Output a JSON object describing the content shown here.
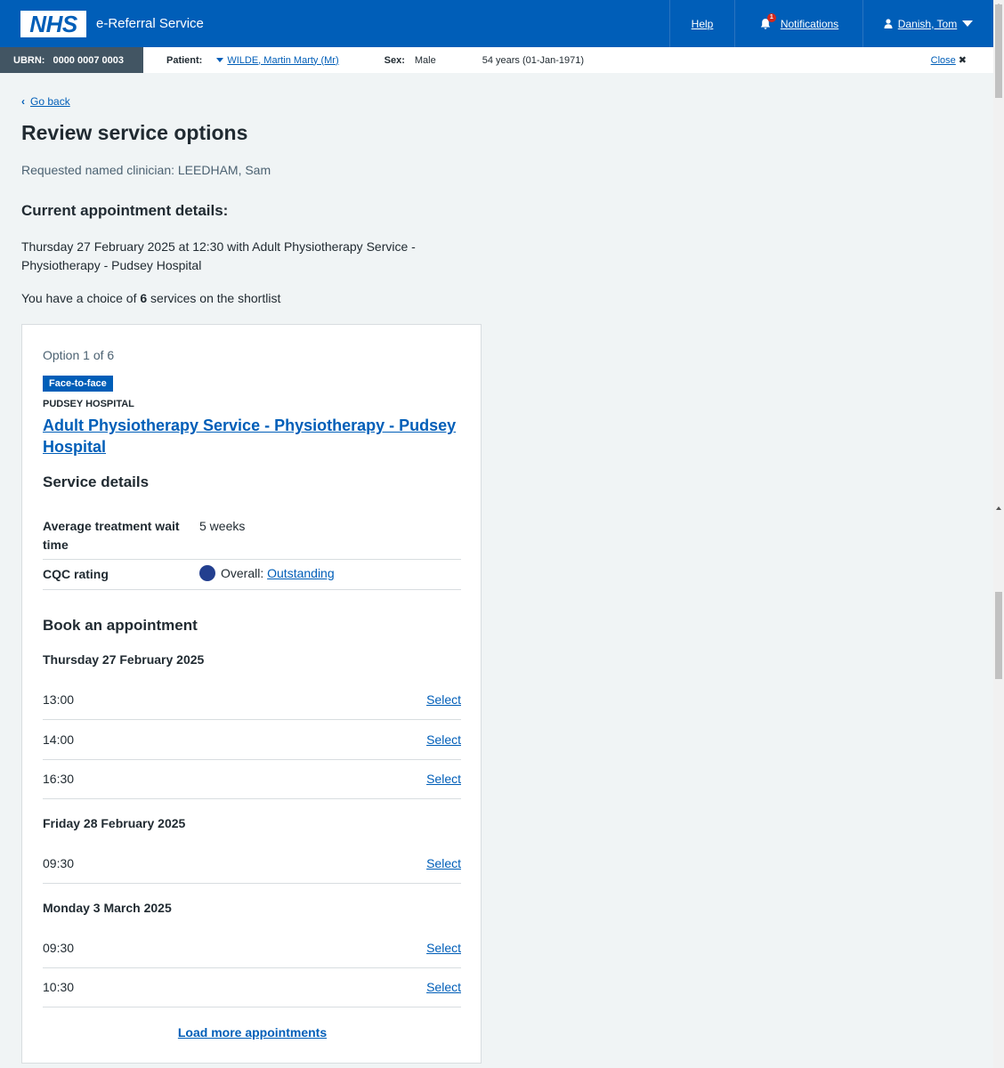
{
  "header": {
    "logo": "NHS",
    "service_name": "e-Referral Service",
    "help": "Help",
    "notifications": "Notifications",
    "notification_count": "1",
    "user": "Danish, Tom"
  },
  "banner": {
    "ubrn_label": "UBRN:",
    "ubrn_value": "0000 0007 0003",
    "patient_label": "Patient:",
    "patient_value": "WILDE, Martin Marty (Mr)",
    "sex_label": "Sex:",
    "sex_value": "Male",
    "age": "54 years (01-Jan-1971)",
    "close": "Close"
  },
  "page": {
    "back": "Go back",
    "title": "Review service options",
    "requested": "Requested named clinician: LEEDHAM, Sam",
    "current_heading": "Current appointment details:",
    "current_text": "Thursday 27 February 2025 at 12:30 with Adult Physiotherapy Service - Physiotherapy - Pudsey Hospital",
    "choice_prefix": "You have a choice of ",
    "choice_count": "6",
    "choice_suffix": " services on the shortlist"
  },
  "card": {
    "option": "Option 1 of 6",
    "tag": "Face-to-face",
    "hospital": "PUDSEY HOSPITAL",
    "service_name": "Adult Physiotherapy Service - Physiotherapy - Pudsey Hospital",
    "service_details_heading": "Service details",
    "wait_label": "Average treatment wait time",
    "wait_value": "5 weeks",
    "cqc_label": "CQC rating",
    "cqc_prefix": "Overall:",
    "cqc_value": "Outstanding",
    "cqc_color": "#233f8f",
    "book_heading": "Book an appointment",
    "select_label": "Select",
    "days": [
      {
        "date": "Thursday 27 February 2025",
        "slots": [
          "13:00",
          "14:00",
          "16:30"
        ]
      },
      {
        "date": "Friday 28 February 2025",
        "slots": [
          "09:30"
        ]
      },
      {
        "date": "Monday 3 March 2025",
        "slots": [
          "09:30",
          "10:30"
        ]
      }
    ],
    "load_more": "Load more appointments"
  }
}
